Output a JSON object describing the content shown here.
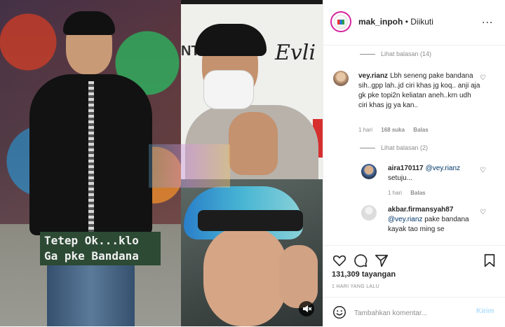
{
  "header": {
    "username": "mak_inpoh",
    "separator": "•",
    "follow_status": "Diikuti",
    "more": "..."
  },
  "media": {
    "caption_line1": "Tetep Ok...klo",
    "caption_line2": "Ga pke Bandana",
    "poster_text": "Evli",
    "poster_text2": "NT",
    "mute_icon": "mute-icon"
  },
  "comments": {
    "view_replies_top": "Lihat balasan (14)",
    "c1": {
      "user": "vey.rianz",
      "text": "Lbh seneng pake bandana sih..gpp lah..jd ciri khas jg koq.. anji aja gk pke topi2n keliatan aneh..krn udh ciri khas jg ya kan..",
      "time": "1 hari",
      "likes": "168 suka",
      "reply": "Balas"
    },
    "view_replies_c1": "Lihat balasan (2)",
    "r1": {
      "user": "aira170117",
      "mention": "@vey.rianz",
      "text": "setuju...",
      "time": "1 hari",
      "reply": "Balas"
    },
    "r2": {
      "user": "akbar.firmansyah87",
      "mention": "@vey.rianz",
      "text": "pake bandana kayak tao ming se"
    }
  },
  "stats": {
    "views": "131,309 tayangan",
    "date": "1 HARI YANG LALU"
  },
  "composer": {
    "placeholder": "Tambahkan komentar...",
    "post_label": "Kirim"
  },
  "colors": {
    "accent_ring": "#d6249f",
    "link": "#00376b",
    "post_disabled": "#b2dffc",
    "caption_bg": "#2c4a34"
  }
}
